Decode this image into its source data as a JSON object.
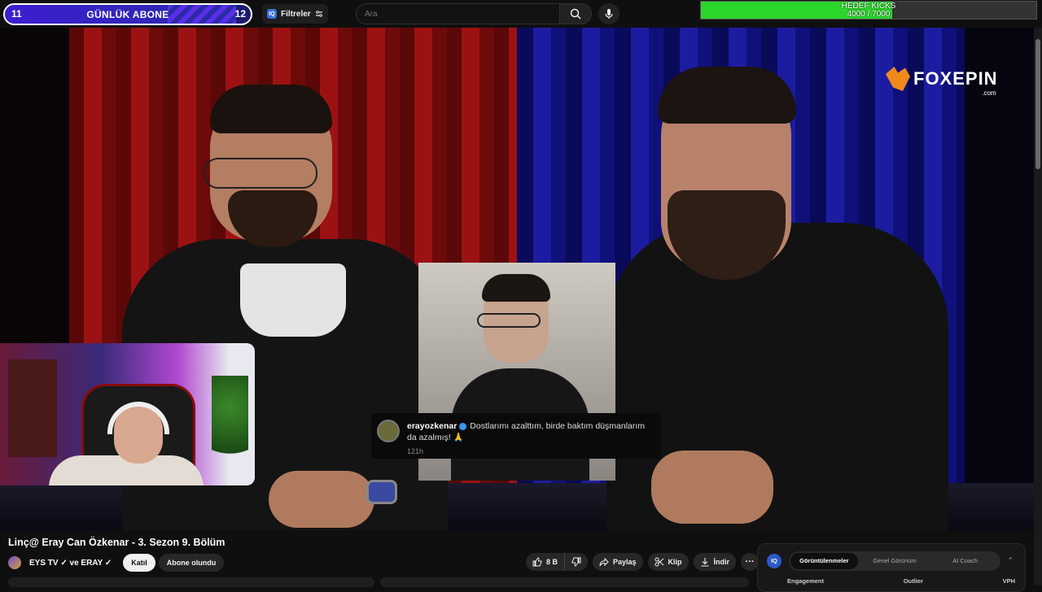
{
  "overlay": {
    "subscriber_goal": {
      "current": "11",
      "label": "GÜNLÜK ABONE",
      "target": "12",
      "progress": 0.92
    },
    "kick_goal": {
      "title": "HEDEF KICKS",
      "value": "4000 / 7000",
      "progress": 0.571
    }
  },
  "header": {
    "filter_label": "Filtreler",
    "filter_badge": "IQ",
    "search_placeholder": "Ara"
  },
  "video": {
    "sponsor_logo": "FOXEPIN",
    "sponsor_logo_suffix": ".com",
    "instagram_comment": {
      "username": "erayozkenar",
      "text": "Dostlarımı azalttım, birde baktım düşmanlarım da azalmış! 🙏",
      "time": "121h"
    }
  },
  "details": {
    "title": "Linç@ Eray Can Özkenar - 3. Sezon 9. Bölüm",
    "channel_names": "EYS TV ✓ ve ERAY ✓",
    "join_label": "Katıl",
    "subscribed_label": "Abone olundu",
    "actions": {
      "likes": "8 B",
      "share": "Paylaş",
      "clip": "Klip",
      "download": "İndir",
      "more": "···"
    }
  },
  "iq_panel": {
    "logo": "IQ",
    "tabs": [
      "Görüntülenmeler",
      "Genel Görünüm",
      "AI Coach"
    ],
    "active_tab": 0,
    "columns": [
      "Engagement",
      "Outlier",
      "VPH"
    ],
    "collapse_icon": "chevron-up-icon"
  },
  "colors": {
    "accent_green": "#2bd62b",
    "sub_bar": "#3b1fd1",
    "sponsor_orange": "#f08a1c",
    "youtube_bg": "#0f0f0f"
  }
}
